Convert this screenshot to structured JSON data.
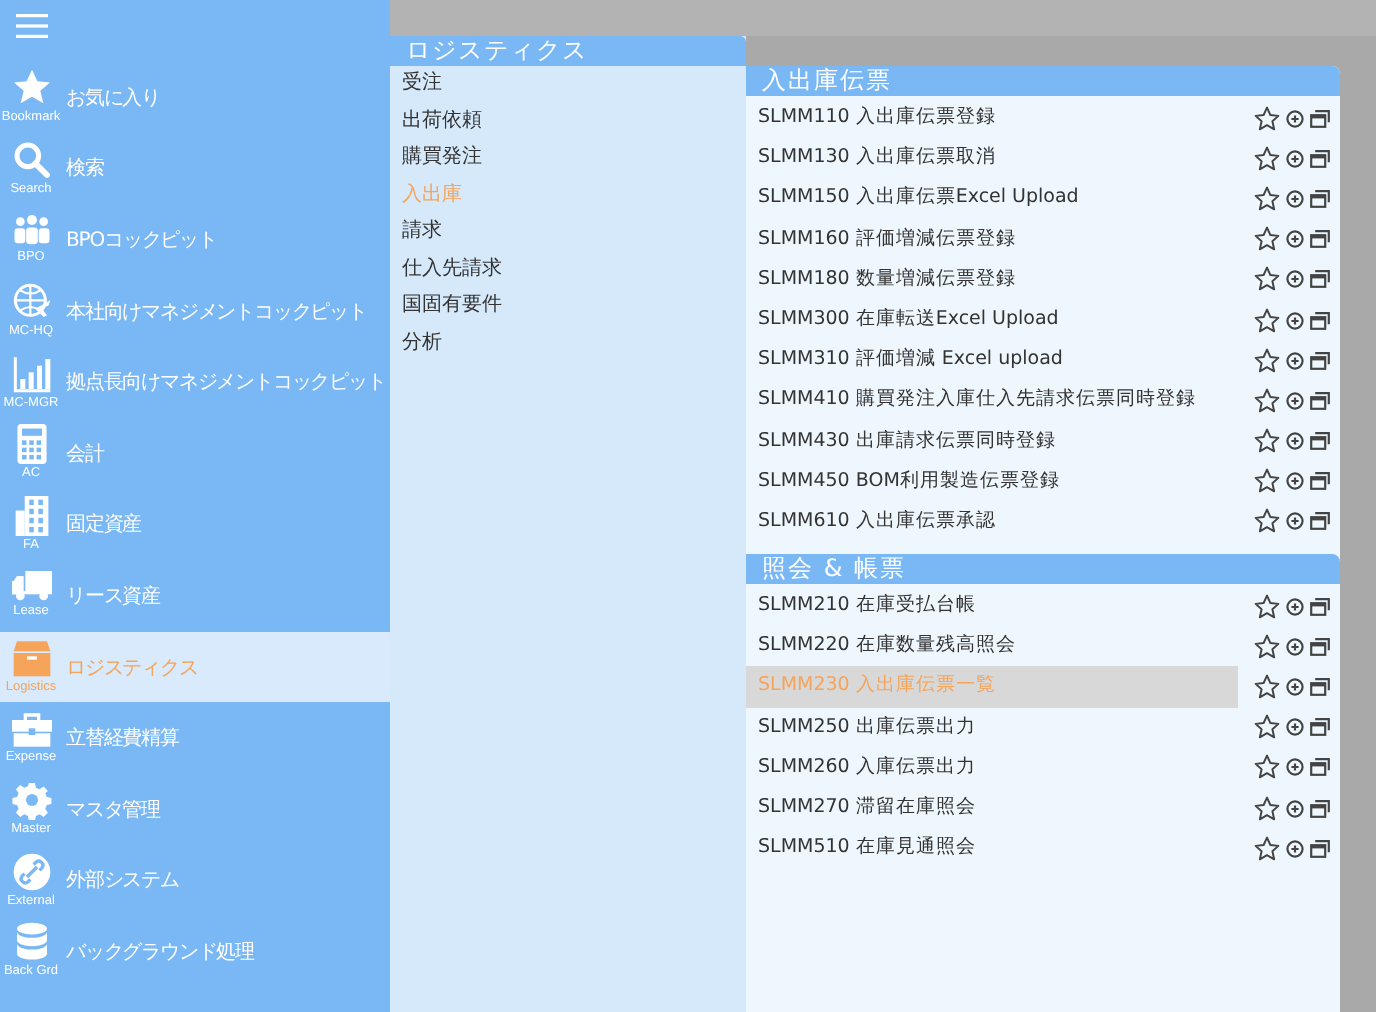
{
  "sidebar": {
    "items": [
      {
        "caption": "Bookmark",
        "label": "お気に入り",
        "selected": false
      },
      {
        "caption": "Search",
        "label": "検索",
        "selected": false
      },
      {
        "caption": "BPO",
        "label": "BPOコックピット",
        "selected": false
      },
      {
        "caption": "MC-HQ",
        "label": "本社向けマネジメントコックピット",
        "selected": false
      },
      {
        "caption": "MC-MGR",
        "label": "拠点長向けマネジメントコックピット",
        "selected": false
      },
      {
        "caption": "AC",
        "label": "会計",
        "selected": false
      },
      {
        "caption": "FA",
        "label": "固定資産",
        "selected": false
      },
      {
        "caption": "Lease",
        "label": "リース資産",
        "selected": false
      },
      {
        "caption": "Logistics",
        "label": "ロジスティクス",
        "selected": true
      },
      {
        "caption": "Expense",
        "label": "立替経費精算",
        "selected": false
      },
      {
        "caption": "Master",
        "label": "マスタ管理",
        "selected": false
      },
      {
        "caption": "External",
        "label": "外部システム",
        "selected": false
      },
      {
        "caption": "Back Grd",
        "label": "バックグラウンド処理",
        "selected": false
      }
    ]
  },
  "submenu": {
    "title": "ロジスティクス",
    "items": [
      {
        "label": "受注",
        "selected": false
      },
      {
        "label": "出荷依頼",
        "selected": false
      },
      {
        "label": "購買発注",
        "selected": false
      },
      {
        "label": "入出庫",
        "selected": true
      },
      {
        "label": "請求",
        "selected": false
      },
      {
        "label": "仕入先請求",
        "selected": false
      },
      {
        "label": "国固有要件",
        "selected": false
      },
      {
        "label": "分析",
        "selected": false
      }
    ]
  },
  "sections": [
    {
      "title": "入出庫伝票",
      "rows": [
        {
          "label": "SLMM110 入出庫伝票登録",
          "selected": false
        },
        {
          "label": "SLMM130 入出庫伝票取消",
          "selected": false
        },
        {
          "label": "SLMM150 入出庫伝票Excel Upload",
          "selected": false
        },
        {
          "label": "SLMM160 評価増減伝票登録",
          "selected": false
        },
        {
          "label": "SLMM180 数量増減伝票登録",
          "selected": false
        },
        {
          "label": "SLMM300 在庫転送Excel Upload",
          "selected": false
        },
        {
          "label": "SLMM310 評価増減 Excel upload",
          "selected": false
        },
        {
          "label": "SLMM410 購買発注入庫仕入先請求伝票同時登録",
          "selected": false
        },
        {
          "label": "SLMM430 出庫請求伝票同時登録",
          "selected": false
        },
        {
          "label": "SLMM450 BOM利用製造伝票登録",
          "selected": false
        },
        {
          "label": "SLMM610 入出庫伝票承認",
          "selected": false
        }
      ]
    },
    {
      "title": "照会 & 帳票",
      "rows": [
        {
          "label": "SLMM210 在庫受払台帳",
          "selected": false
        },
        {
          "label": "SLMM220 在庫数量残高照会",
          "selected": false
        },
        {
          "label": "SLMM230 入出庫伝票一覧",
          "selected": true
        },
        {
          "label": "SLMM250 出庫伝票出力",
          "selected": false
        },
        {
          "label": "SLMM260 入庫伝票出力",
          "selected": false
        },
        {
          "label": "SLMM270 滞留在庫照会",
          "selected": false
        },
        {
          "label": "SLMM510 在庫見通照会",
          "selected": false
        }
      ]
    }
  ]
}
